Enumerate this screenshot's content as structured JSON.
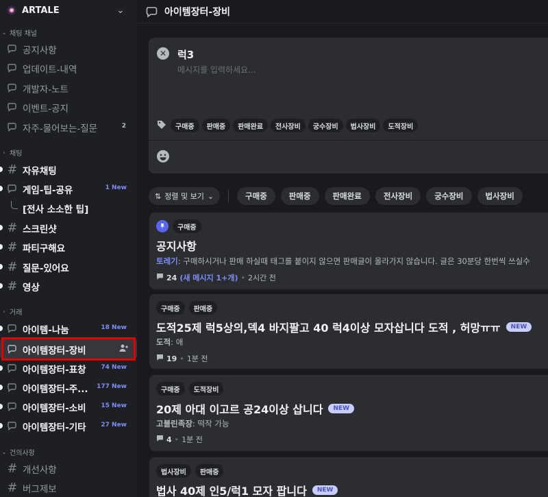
{
  "server": {
    "name": "ARTALE"
  },
  "topbar": {
    "title": "아이템장터-장비"
  },
  "sidebar": {
    "categories": [
      {
        "name": "채팅 채널",
        "channels": [
          {
            "name": "공지사항",
            "icon": "forum-icon"
          },
          {
            "name": "업데이트-내역",
            "icon": "forum-icon"
          },
          {
            "name": "개발자-노트",
            "icon": "forum-icon"
          },
          {
            "name": "이벤트-공지",
            "icon": "forum-icon"
          },
          {
            "name": "자주-물어보는-질문",
            "icon": "forum-icon",
            "count": "2"
          }
        ]
      },
      {
        "name": "채팅",
        "channels": [
          {
            "name": "자유채팅",
            "icon": "hash-icon",
            "unread": true
          },
          {
            "name": "게임-팁-공유",
            "icon": "forum-icon",
            "unread": true,
            "badge": "1 New"
          },
          {
            "name": "[전사 소소한 팁]",
            "icon": "thread-icon",
            "unread": true
          },
          {
            "name": "스크린샷",
            "icon": "hash-icon",
            "unread": true
          },
          {
            "name": "파티구해요",
            "icon": "hash-icon",
            "unread": true
          },
          {
            "name": "질문-있어요",
            "icon": "hash-icon",
            "unread": true
          },
          {
            "name": "영상",
            "icon": "hash-icon",
            "unread": true
          }
        ]
      },
      {
        "name": "거래",
        "channels": [
          {
            "name": "아이템-나눔",
            "icon": "forum-icon",
            "unread": true,
            "badge": "18 New"
          },
          {
            "name": "아이템장터-장비",
            "icon": "forum-icon",
            "selected": true
          },
          {
            "name": "아이템장터-표창",
            "icon": "forum-icon",
            "unread": true,
            "badge": "74 New"
          },
          {
            "name": "아이템장터-주...",
            "icon": "forum-icon",
            "unread": true,
            "badge": "177 New"
          },
          {
            "name": "아이템장터-소비",
            "icon": "forum-icon",
            "unread": true,
            "badge": "15 New"
          },
          {
            "name": "아이템장터-기타",
            "icon": "forum-icon",
            "unread": true,
            "badge": "27 New"
          }
        ]
      },
      {
        "name": "건의사항",
        "channels": [
          {
            "name": "개선사항",
            "icon": "hash-icon"
          },
          {
            "name": "버그제보",
            "icon": "hash-icon"
          }
        ]
      }
    ]
  },
  "composer": {
    "title": "럭3",
    "placeholder": "메시지를 입력하세요...",
    "tags": [
      "구매중",
      "판매중",
      "판매완료",
      "전사장비",
      "궁수장비",
      "법사장비",
      "도적장비"
    ]
  },
  "filters": {
    "sort_label": "정렬 및 보기",
    "tags": [
      "구매중",
      "판매중",
      "판매완료",
      "전사장비",
      "궁수장비",
      "법사장비"
    ]
  },
  "posts": [
    {
      "pinned": true,
      "tags": [
        "구매중"
      ],
      "title": "공지사항",
      "is_new": false,
      "author": "토레기",
      "preview": "구매하시거나 판매 하실때 태그를 붙이지 않으면 판매글이 올라가지 않습니다. 글은 30분당 한번씩 쓰실수",
      "replies": "24",
      "new_messages": "(새 메시지 1+개)",
      "time": "2시간 전"
    },
    {
      "pinned": false,
      "tags": [
        "구매중",
        "판매중"
      ],
      "title": "도적25제 럭5상의,덱4 바지팔고 40 럭4이상 모자삽니다 도적 , 허망ㅠㅠ",
      "is_new": true,
      "author": "도적",
      "preview": "애",
      "replies": "19",
      "new_messages": "",
      "time": "1분 전"
    },
    {
      "pinned": false,
      "tags": [
        "구매중",
        "도적장비"
      ],
      "title": "20제 아대 이고르 공24이상 삽니다",
      "is_new": true,
      "author": "고블린족장",
      "preview": "떡작 가능",
      "replies": "4",
      "new_messages": "",
      "time": "1분 전"
    },
    {
      "pinned": false,
      "tags": [
        "법사장비",
        "판매중"
      ],
      "title": "법사 40제 인5/럭1 모자 팝니다",
      "is_new": true,
      "author": "",
      "preview": "",
      "replies": "",
      "new_messages": "",
      "time": ""
    }
  ],
  "labels": {
    "new_badge": "NEW",
    "sep": ":"
  },
  "colors": {
    "accent": "#5865f2",
    "highlight_box": "#e50000",
    "new_badge_bg": "#c9cdfb"
  }
}
